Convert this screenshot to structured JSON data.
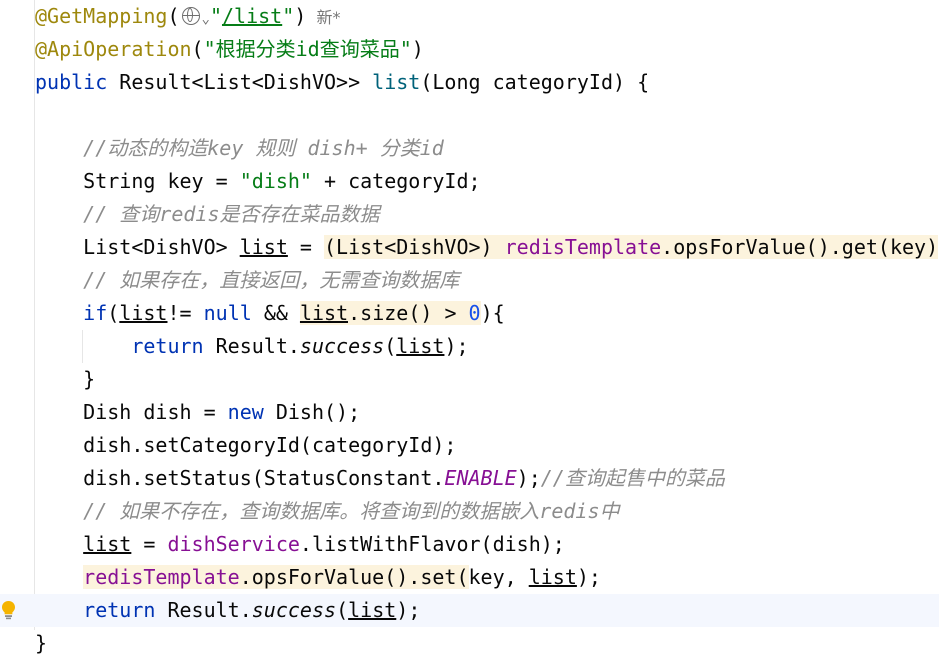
{
  "editor": {
    "language": "java",
    "lines": [
      [
        {
          "t": "@GetMapping",
          "c": "#9e880d"
        },
        {
          "t": "(",
          "c": "#080808"
        },
        {
          "t": "[globe-icon]",
          "c": "#6e6e6e",
          "icon": "globe"
        },
        {
          "t": "\"",
          "c": "#067d17"
        },
        {
          "t": "/list",
          "c": "#067d17",
          "u": true
        },
        {
          "t": "\"",
          "c": "#067d17"
        },
        {
          "t": ")",
          "c": "#080808"
        },
        {
          "t": "  新*",
          "c": "#787878",
          "meta": true
        }
      ],
      [
        {
          "t": "@ApiOperation",
          "c": "#9e880d"
        },
        {
          "t": "(",
          "c": "#080808"
        },
        {
          "t": "\"根据分类id查询菜品\"",
          "c": "#067d17"
        },
        {
          "t": ")",
          "c": "#080808"
        }
      ],
      [
        {
          "t": "public ",
          "c": "#0033b3"
        },
        {
          "t": "Result<List<DishVO>> ",
          "c": "#080808"
        },
        {
          "t": "list",
          "c": "#00627a"
        },
        {
          "t": "(Long categoryId) {",
          "c": "#080808"
        }
      ],
      [],
      [
        {
          "t": "    //动态的构造key 规则 dish+ 分类id",
          "c": "#8c8c8c",
          "i": true
        }
      ],
      [
        {
          "t": "    String key = ",
          "c": "#080808"
        },
        {
          "t": "\"dish\"",
          "c": "#067d17"
        },
        {
          "t": " + categoryId;",
          "c": "#080808"
        }
      ],
      [
        {
          "t": "    // 查询redis是否存在菜品数据",
          "c": "#8c8c8c",
          "i": true
        }
      ],
      [
        {
          "t": "    List<DishVO> ",
          "c": "#080808"
        },
        {
          "t": "list",
          "c": "#080808",
          "u": true
        },
        {
          "t": " = ",
          "c": "#080808"
        },
        {
          "t": "(List<DishVO>) ",
          "c": "#080808",
          "h": true
        },
        {
          "t": "redisTemplate",
          "c": "#871094",
          "h": true
        },
        {
          "t": ".opsForValue().get(key)",
          "c": "#080808",
          "h": true
        }
      ],
      [
        {
          "t": "    // 如果存在，直接返回，无需查询数据库",
          "c": "#8c8c8c",
          "i": true
        }
      ],
      [
        {
          "t": "    ",
          "c": "#080808"
        },
        {
          "t": "if",
          "c": "#0033b3"
        },
        {
          "t": "(",
          "c": "#080808"
        },
        {
          "t": "list",
          "c": "#080808",
          "u": true
        },
        {
          "t": "!= ",
          "c": "#080808"
        },
        {
          "t": "null",
          "c": "#0033b3"
        },
        {
          "t": " && ",
          "c": "#080808"
        },
        {
          "t": "list",
          "c": "#080808",
          "u": true,
          "h": true
        },
        {
          "t": ".size() > ",
          "c": "#080808",
          "h": true
        },
        {
          "t": "0",
          "c": "#1750eb",
          "h": true
        },
        {
          "t": "){",
          "c": "#080808"
        }
      ],
      [
        {
          "t": "        ",
          "c": "#080808"
        },
        {
          "t": "return ",
          "c": "#0033b3"
        },
        {
          "t": "Result.",
          "c": "#080808"
        },
        {
          "t": "success",
          "c": "#080808",
          "i": true
        },
        {
          "t": "(",
          "c": "#080808"
        },
        {
          "t": "list",
          "c": "#080808",
          "u": true
        },
        {
          "t": ");",
          "c": "#080808"
        }
      ],
      [
        {
          "t": "    }",
          "c": "#080808"
        }
      ],
      [
        {
          "t": "    Dish dish = ",
          "c": "#080808"
        },
        {
          "t": "new ",
          "c": "#0033b3"
        },
        {
          "t": "Dish();",
          "c": "#080808"
        }
      ],
      [
        {
          "t": "    dish.setCategoryId(categoryId);",
          "c": "#080808"
        }
      ],
      [
        {
          "t": "    dish.setStatus(StatusConstant.",
          "c": "#080808"
        },
        {
          "t": "ENABLE",
          "c": "#871094",
          "i": true
        },
        {
          "t": ");",
          "c": "#080808"
        },
        {
          "t": "//查询起售中的菜品",
          "c": "#8c8c8c",
          "i": true
        }
      ],
      [
        {
          "t": "    // 如果不存在，查询数据库。将查询到的数据嵌入redis中",
          "c": "#8c8c8c",
          "i": true
        }
      ],
      [
        {
          "t": "    ",
          "c": "#080808"
        },
        {
          "t": "list",
          "c": "#080808",
          "u": true
        },
        {
          "t": " = ",
          "c": "#080808"
        },
        {
          "t": "dishService",
          "c": "#871094"
        },
        {
          "t": ".listWithFlavor(dish);",
          "c": "#080808"
        }
      ],
      [
        {
          "t": "    ",
          "c": "#080808"
        },
        {
          "t": "redisTemplate",
          "c": "#871094",
          "h": true
        },
        {
          "t": ".opsForValue().set(",
          "c": "#080808",
          "h": true
        },
        {
          "t": "key, ",
          "c": "#080808"
        },
        {
          "t": "list",
          "c": "#080808",
          "u": true
        },
        {
          "t": ");",
          "c": "#080808"
        }
      ],
      [
        {
          "t": "    ",
          "c": "#080808"
        },
        {
          "t": "return ",
          "c": "#0033b3"
        },
        {
          "t": "Result.",
          "c": "#080808"
        },
        {
          "t": "success",
          "c": "#080808",
          "i": true
        },
        {
          "t": "(",
          "c": "#080808"
        },
        {
          "t": "list",
          "c": "#080808",
          "u": true
        },
        {
          "t": ");",
          "c": "#080808"
        }
      ],
      [
        {
          "t": "}",
          "c": "#080808"
        }
      ]
    ]
  },
  "gutter": {
    "intention_icon": "lightbulb-icon"
  },
  "colors": {
    "background": "#ffffff",
    "caret_line": "#f4f7fe",
    "highlight": "#fcf3dd",
    "annotation": "#9e880d",
    "keyword": "#0033b3",
    "string": "#067d17",
    "comment": "#8c8c8c",
    "field": "#871094",
    "method_decl": "#00627a",
    "number": "#1750eb"
  }
}
